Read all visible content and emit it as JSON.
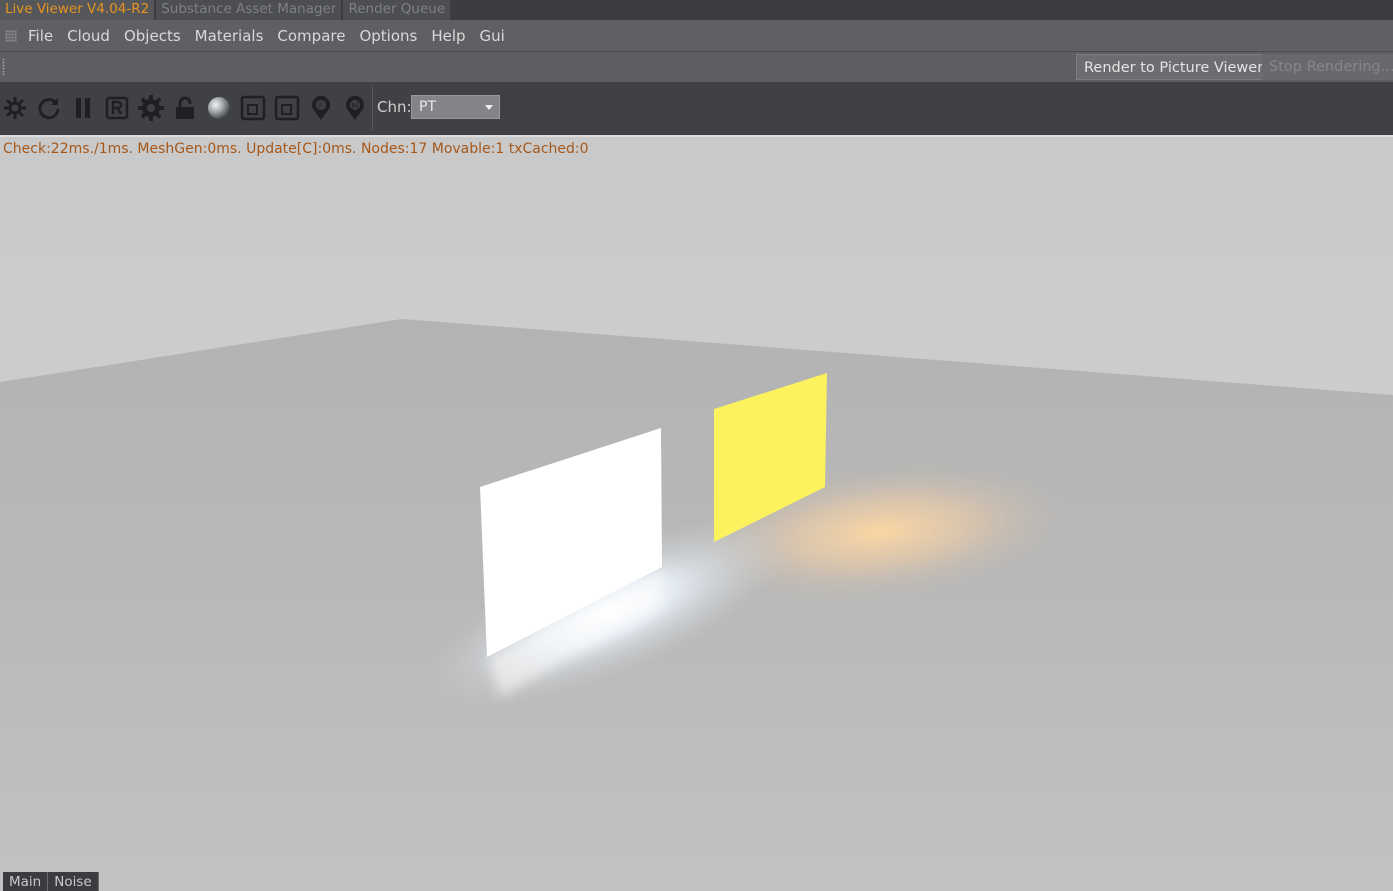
{
  "tabs": [
    {
      "label": "Live Viewer V4.04-R2",
      "active": true
    },
    {
      "label": "Substance Asset Manager",
      "active": false
    },
    {
      "label": "Render Queue",
      "active": false
    }
  ],
  "menu": [
    "File",
    "Cloud",
    "Objects",
    "Materials",
    "Compare",
    "Options",
    "Help",
    "Gui"
  ],
  "render_buttons": {
    "render_to_picture_viewer": "Render to Picture Viewer",
    "stop_rendering": "Stop Rendering..."
  },
  "toolbar": {
    "icons": [
      "send-scene-icon",
      "restart-icon",
      "pause-icon",
      "region-render-icon",
      "settings-gear-icon",
      "lock-icon",
      "material-ball-icon",
      "focus-frame-icon",
      "focus-frame-alt-icon",
      "focus-pick-icon",
      "material-pick-icon"
    ],
    "channel_label": "Chn:",
    "channel_value": "PT"
  },
  "viewport": {
    "stats": "Check:22ms./1ms. MeshGen:0ms. Update[C]:0ms. Nodes:17 Movable:1 txCached:0",
    "stats_color": "#a6581a",
    "light_panels": [
      {
        "name": "white-emitter-panel",
        "color": "#ffffff"
      },
      {
        "name": "yellow-emitter-panel",
        "color": "#fbf25e"
      }
    ]
  },
  "bottom_tabs": [
    "Main",
    "Noise"
  ],
  "colors": {
    "active_tab": "#e8951f",
    "toolbar_bg": "#404144",
    "menubar_bg": "#5f6064"
  }
}
